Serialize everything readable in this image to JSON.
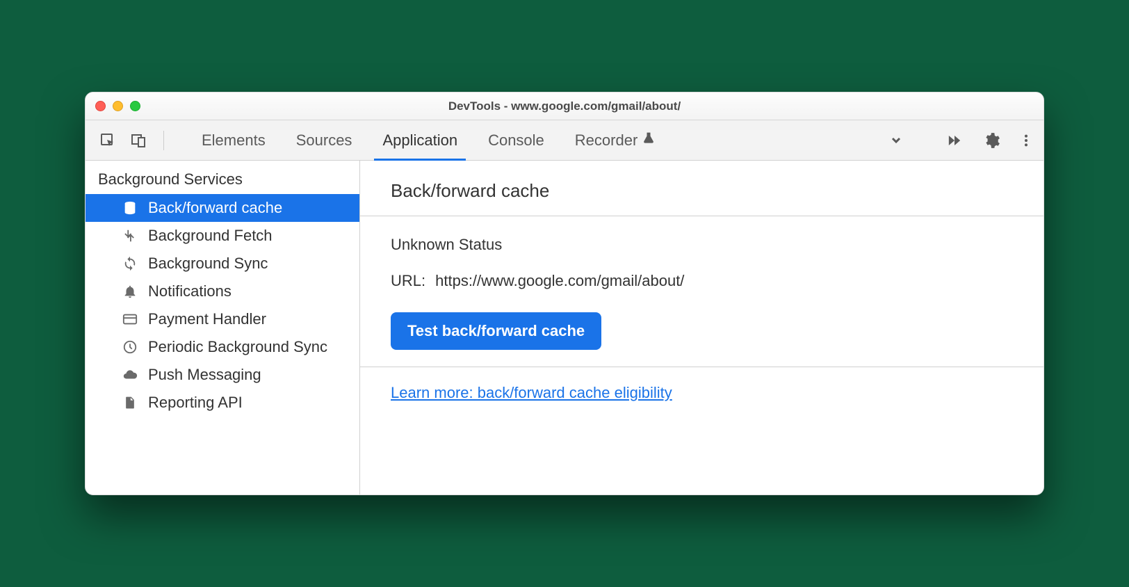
{
  "window": {
    "title": "DevTools - www.google.com/gmail/about/"
  },
  "tabs": {
    "items": [
      "Elements",
      "Sources",
      "Application",
      "Console",
      "Recorder"
    ],
    "active_index": 2
  },
  "sidebar": {
    "section": "Background Services",
    "items": [
      {
        "label": "Back/forward cache",
        "icon": "database-icon"
      },
      {
        "label": "Background Fetch",
        "icon": "fetch-icon"
      },
      {
        "label": "Background Sync",
        "icon": "sync-icon"
      },
      {
        "label": "Notifications",
        "icon": "bell-icon"
      },
      {
        "label": "Payment Handler",
        "icon": "card-icon"
      },
      {
        "label": "Periodic Background Sync",
        "icon": "clock-icon"
      },
      {
        "label": "Push Messaging",
        "icon": "cloud-icon"
      },
      {
        "label": "Reporting API",
        "icon": "file-icon"
      }
    ],
    "active_index": 0
  },
  "main": {
    "heading": "Back/forward cache",
    "status": "Unknown Status",
    "url_label": "URL:",
    "url_value": "https://www.google.com/gmail/about/",
    "test_button": "Test back/forward cache",
    "learn_more": "Learn more: back/forward cache eligibility"
  }
}
